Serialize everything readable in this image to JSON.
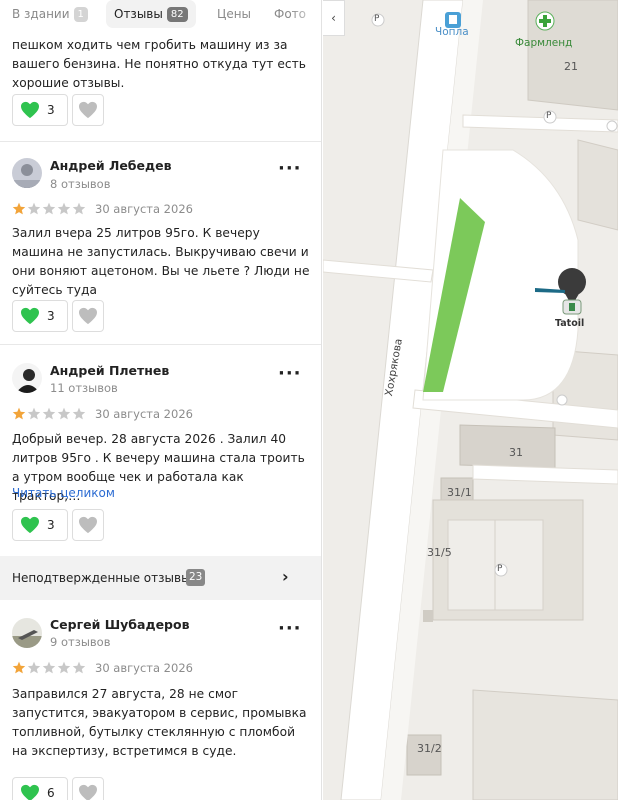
{
  "tabs": [
    {
      "label": "В здании",
      "count": "1"
    },
    {
      "label": "Отзывы",
      "count": "82"
    },
    {
      "label": "Цены",
      "count": ""
    },
    {
      "label": "Фото",
      "count": ""
    }
  ],
  "top_fragment": {
    "text": "пешком ходить чем гробить машину из за вашего бензина. Не понятно откуда тут есть хорошие отзывы.",
    "likes": "3"
  },
  "reviews": [
    {
      "author": "Андрей Лебедев",
      "sub": "8 отзывов",
      "rating": 1,
      "date": "30 августа 2026",
      "text": "Залил вчера 25 литров 95го. К вечеру машина не запустилась. Выкручиваю свечи и они воняют ацетоном. Вы че льете ? Люди не суйтесь туда",
      "likes": "3"
    },
    {
      "author": "Андрей Плетнев",
      "sub": "11 отзывов",
      "rating": 1,
      "date": "30 августа 2026",
      "text": "Добрый вечер. 28 августа 2026 . Залил 40 литров 95го . К вечеру машина стала троить а утром вообще чек и работала как трактор,…",
      "read_more": "Читать целиком",
      "likes": "3"
    },
    {
      "author": "Сергей Шубадеров",
      "sub": "9 отзывов",
      "rating": 1,
      "date": "30 августа 2026",
      "text": "Заправился 27 августа, 28 не смог запустится, эвакуатором в сервис, промывка топливной, бутылку стеклянную с пломбой на экспертизу, встретимся в суде.",
      "likes": "6"
    }
  ],
  "unconfirmed": {
    "label": "Неподтвержденные отзывы",
    "count": "23"
  },
  "map": {
    "labels": {
      "chopa": "Чопла",
      "farmlend": "Фармленд",
      "tatoil": "Tatoil",
      "street": "Хохрякова",
      "b21": "21",
      "b31": "31",
      "b31_1": "31/1",
      "b31_5": "31/5",
      "b31_2": "31/2",
      "parking": "P"
    }
  },
  "colors": {
    "star_filled": "#f2a43a",
    "star_empty": "#c8c8c8",
    "heart_like": "#2fc34f",
    "heart_dislike": "#bdbdbd",
    "link": "#2c6cd2",
    "map_green": "#7cc95a"
  },
  "icons": {
    "like": "green-heart-icon",
    "dislike": "grey-heart-icon",
    "more": "more-dots-icon",
    "star": "star-icon",
    "chevron": "chevron-right-icon",
    "collapse": "chevron-left-icon"
  }
}
